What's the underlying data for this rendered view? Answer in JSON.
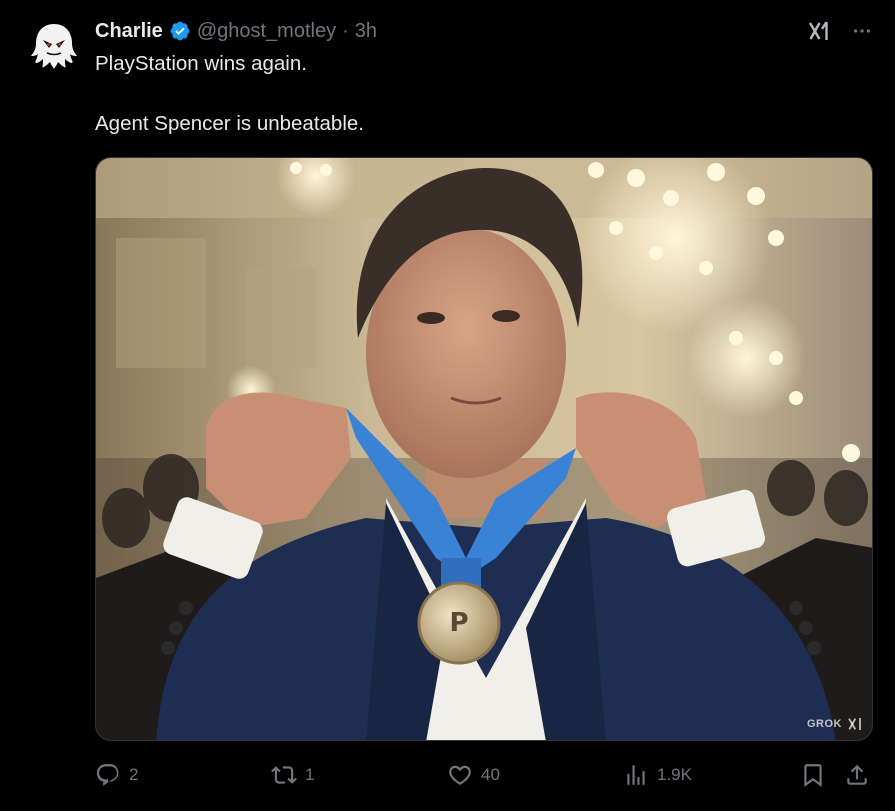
{
  "tweet": {
    "author": {
      "display_name": "Charlie",
      "handle": "@ghost_motley",
      "verified": true,
      "avatar_icon": "ghost-skull-avatar"
    },
    "separator": "·",
    "time": "3h",
    "text_lines": [
      "PlayStation wins again.",
      "Agent Spencer is unbeatable."
    ],
    "media": {
      "watermark": "GROK"
    },
    "actions": {
      "replies": "2",
      "reposts": "1",
      "likes": "40",
      "views": "1.9K"
    }
  },
  "colors": {
    "background": "#000000",
    "text": "#e7e9ea",
    "muted": "#71767b",
    "verified": "#1d9bf0",
    "border": "#2f3336"
  },
  "icons": {
    "grok": "grok-icon",
    "more": "more-icon",
    "reply": "reply-icon",
    "repost": "repost-icon",
    "like": "heart-icon",
    "views": "views-icon",
    "bookmark": "bookmark-icon",
    "share": "share-icon"
  }
}
